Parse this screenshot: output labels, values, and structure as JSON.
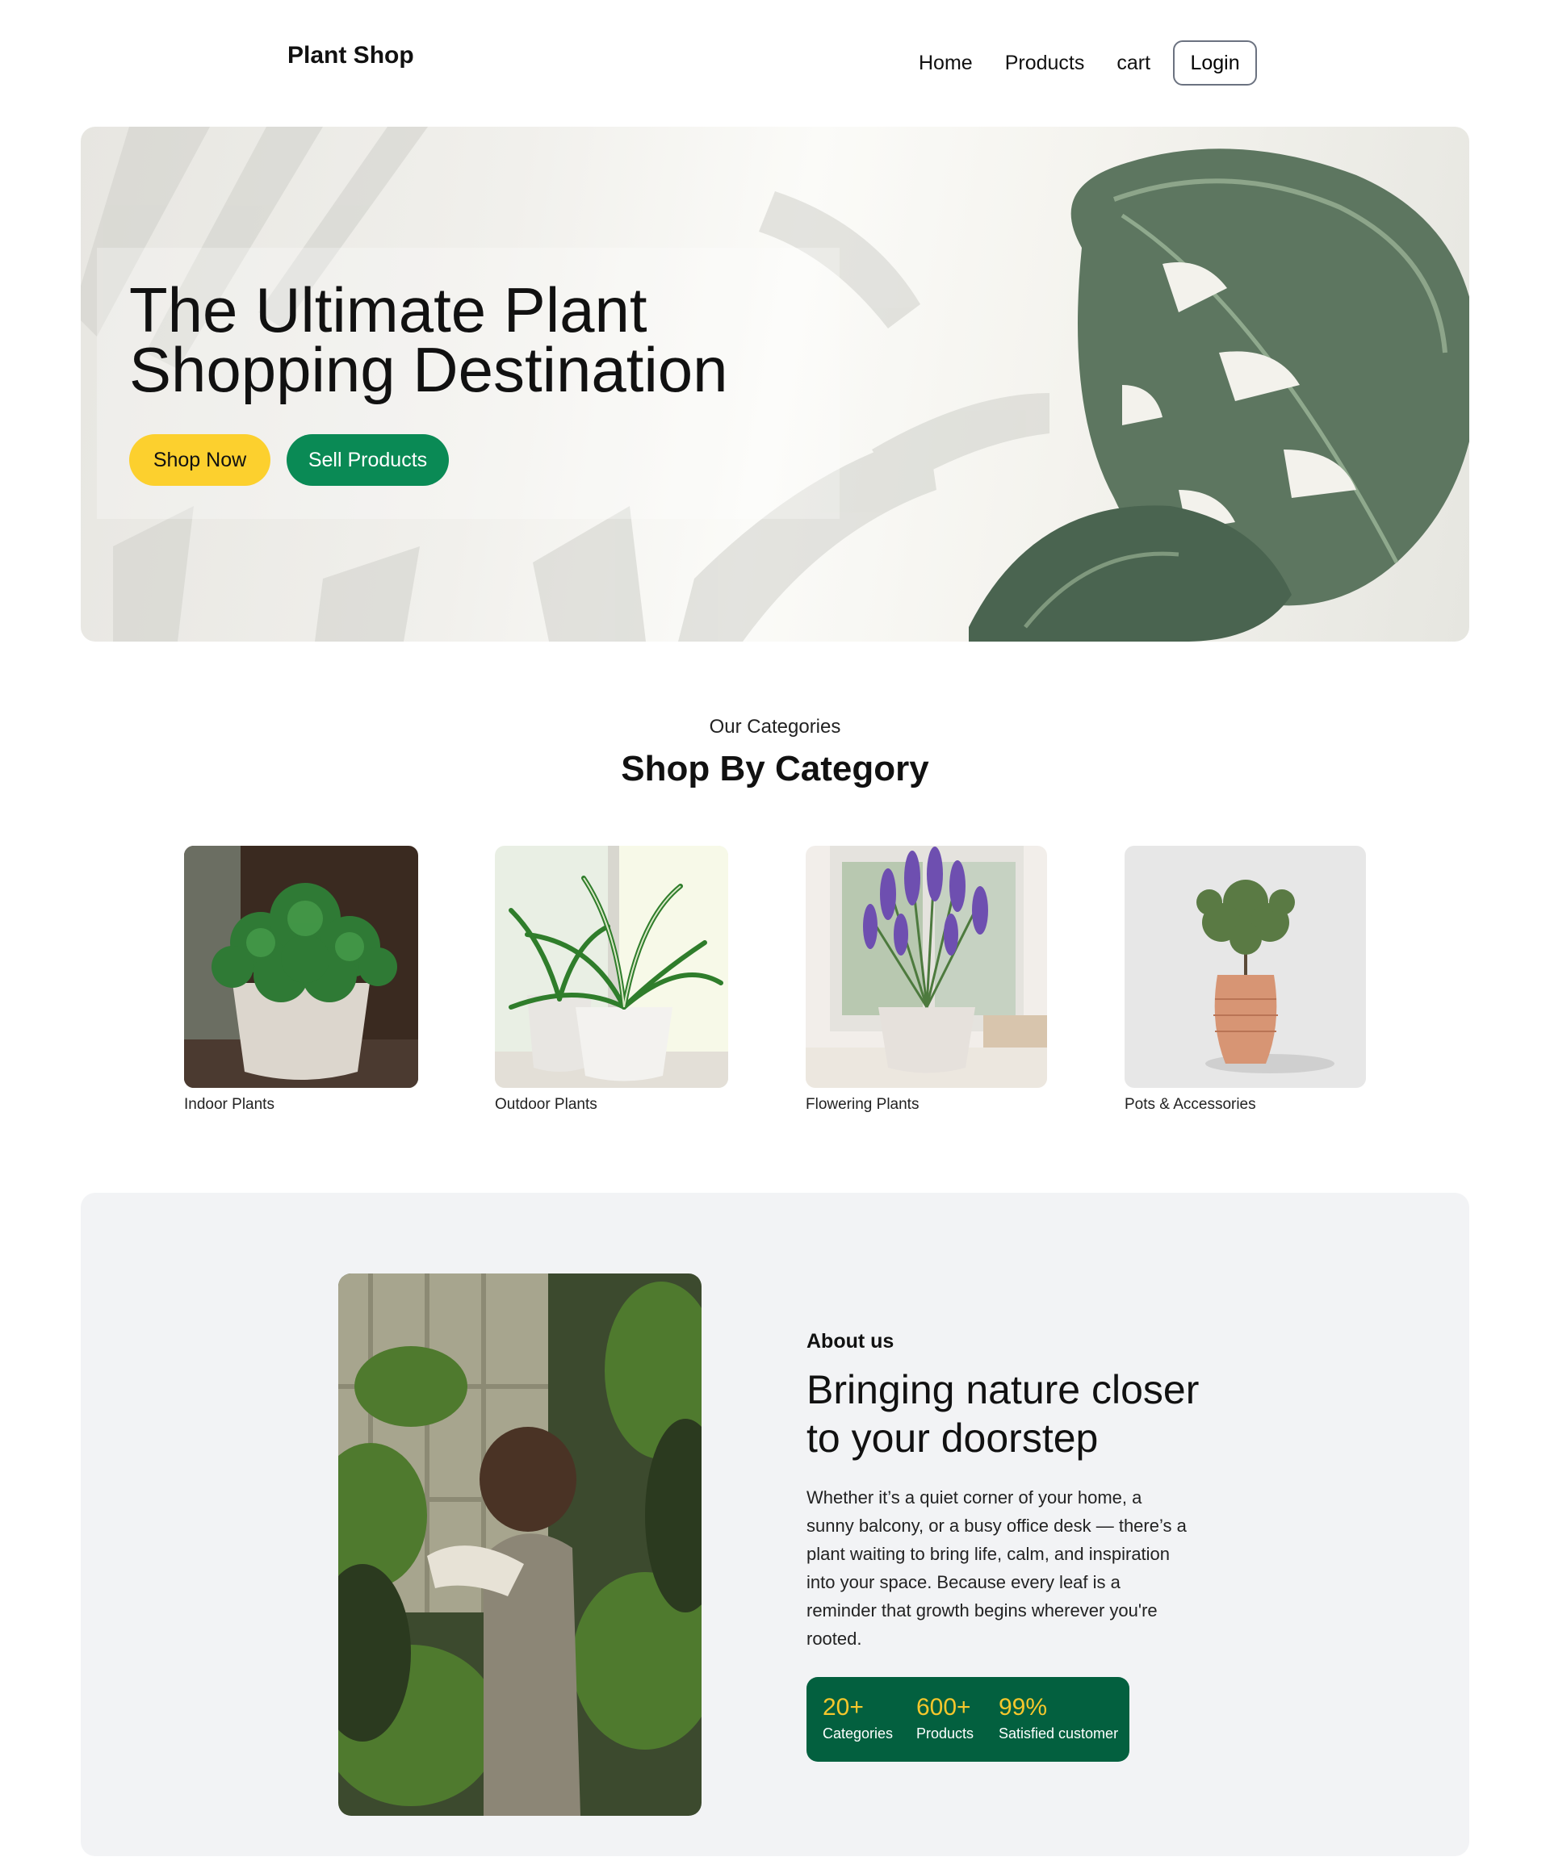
{
  "nav": {
    "brand": "Plant Shop",
    "links": [
      "Home",
      "Products",
      "cart"
    ],
    "login": "Login"
  },
  "hero": {
    "title_line1": "The Ultimate Plant",
    "title_line2": "Shopping Destination",
    "shop_button": "Shop Now",
    "sell_button": "Sell Products"
  },
  "categories": {
    "eyebrow": "Our Categories",
    "heading": "Shop By Category",
    "items": [
      {
        "label": "Indoor Plants"
      },
      {
        "label": "Outdoor Plants"
      },
      {
        "label": "Flowering Plants"
      },
      {
        "label": "Pots & Accessories"
      }
    ]
  },
  "about": {
    "eyebrow": "About us",
    "title_line1": "Bringing nature closer",
    "title_line2": "to your doorstep",
    "text": "Whether it’s a quiet corner of your home, a sunny balcony, or a busy office desk — there’s a plant waiting to bring life, calm, and inspiration into your space. Because every leaf is a reminder that growth begins wherever you're rooted.",
    "stats": [
      {
        "value": "20+",
        "label": "Categories"
      },
      {
        "value": "600+",
        "label": "Products"
      },
      {
        "value": "99%",
        "label": "Satisfied customer"
      }
    ]
  },
  "colors": {
    "accent_yellow": "#fcd02e",
    "accent_green": "#0a8a55",
    "stats_bg": "#03603f",
    "stats_number": "#f6c72c"
  }
}
